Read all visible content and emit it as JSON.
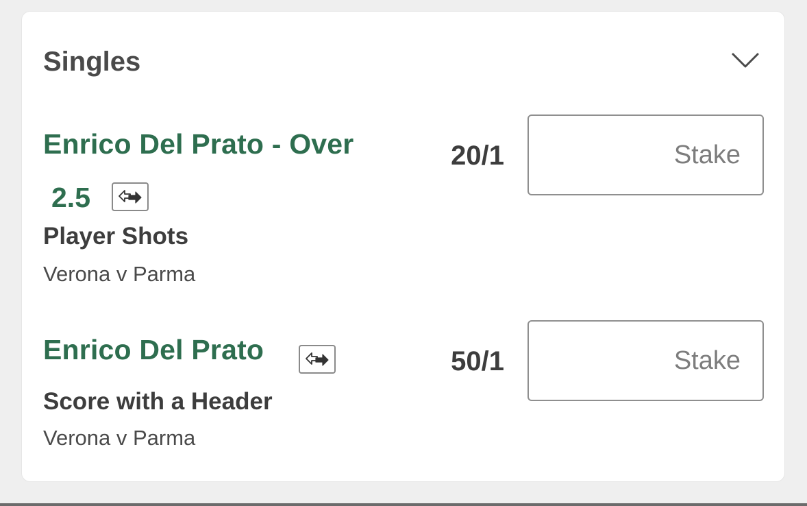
{
  "section": {
    "title": "Singles",
    "toggle_icon": "chevron-down-icon"
  },
  "bets": [
    {
      "selection_line1": "Enrico Del Prato - Over",
      "selection_line2": "2.5",
      "boost_icon": "price-boost-icon",
      "market": "Player Shots",
      "event": "Verona v Parma",
      "odds": "20/1",
      "stake_placeholder": "Stake",
      "stake_value": ""
    },
    {
      "selection_line1": "Enrico Del Prato",
      "boost_icon": "price-boost-icon",
      "market": "Score with a Header",
      "event": "Verona v Parma",
      "odds": "50/1",
      "stake_placeholder": "Stake",
      "stake_value": ""
    }
  ],
  "colors": {
    "selection_green": "#2e6e4f",
    "text_dark": "#3d3d3d",
    "background": "#efefef",
    "card": "#ffffff"
  }
}
